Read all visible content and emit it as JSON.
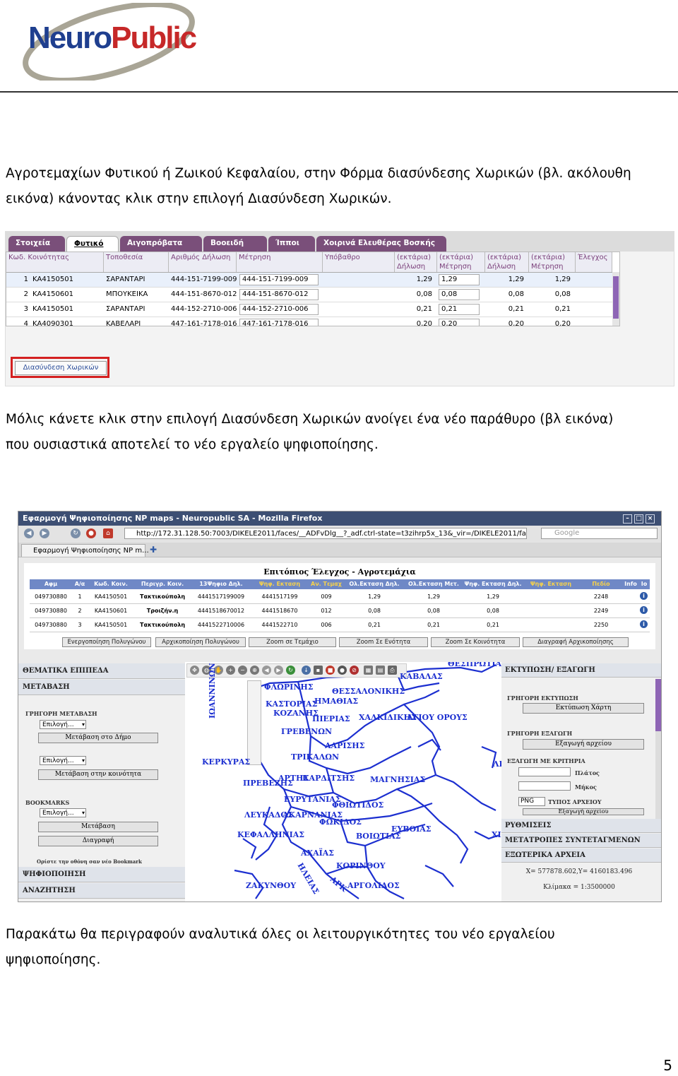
{
  "header": {
    "logo_text_part1": "Neuro",
    "logo_text_part2": "Public",
    "logo_colors": {
      "blue": "#1f3f8f",
      "red": "#c62828",
      "ring": "#a9a596"
    }
  },
  "paragraphs": {
    "p1_line1": "Αγροτεμαχίων Φυτικού ή Ζωικού Κεφαλαίου, στην Φόρμα διασύνδεσης Χωρικών (βλ. ακόλουθη",
    "p1_line2": "εικόνα) κάνοντας κλικ στην επιλογή Διασύνδεση Χωρικών.",
    "p2_line1": "Μόλις κάνετε κλικ στην επιλογή Διασύνδεση Χωρικών ανοίγει ένα νέο παράθυρο (βλ εικόνα)",
    "p2_line2": "που ουσιαστικά αποτελεί το νέο εργαλείο ψηφιοποίησης.",
    "p3_line1": "Παρακάτω θα περιγραφούν αναλυτικά όλες οι λειτουργικότητες του νέο εργαλείου",
    "p3_line2": "ψηφιοποίησης."
  },
  "page_number": "5",
  "screenshot1": {
    "tabs": [
      "Στοιχεία",
      "Φυτικό",
      "Αιγοπρόβατα",
      "Βοοειδή",
      "Ίπποι",
      "Χοιρινά Ελευθέρας Βοσκής"
    ],
    "active_tab": "Φυτικό",
    "headers": [
      "Κωδ. Κοινότητας",
      "Τοποθεσία",
      "Αριθμός Δήλωση",
      "Μέτρηση",
      "Υπόβαθρο",
      "(εκτάρια) Δήλωση",
      "(εκτάρια) Μέτρηση",
      "(εκτάρια) Δήλωση",
      "(εκτάρια) Μέτρηση",
      "Έλεγχος"
    ],
    "rows": [
      [
        "1",
        "ΚΑ4150501",
        "ΣΑΡΑΝΤΑΡΙ",
        "444-151-7199-009",
        "444-151-7199-009",
        "1,29",
        "1,29",
        "1,29",
        "1,29"
      ],
      [
        "2",
        "ΚΑ4150601",
        "ΜΠΟΥΚΕΙΚΑ",
        "444-151-8670-012",
        "444-151-8670-012",
        "0,08",
        "0,08",
        "0,08",
        "0,08"
      ],
      [
        "3",
        "ΚΑ4150501",
        "ΣΑΡΑΝΤΑΡΙ",
        "444-152-2710-006",
        "444-152-2710-006",
        "0,21",
        "0,21",
        "0,21",
        "0,21"
      ],
      [
        "4",
        "ΚΑ4090301",
        "ΚΑΒΕΛΑΡΙ",
        "447-161-7178-016",
        "447-161-7178-016",
        "0,20",
        "0,20",
        "0,20",
        "0,20"
      ]
    ],
    "link_button": "Διασύνδεση Χωρικών",
    "highlight_color": "#d42020"
  },
  "screenshot2": {
    "window_title": "Εφαρμογή Ψηφιοποίησης NP maps - Neuropublic SA - Mozilla Firefox",
    "url": "http://172.31.128.50:7003/DIKELE2011/faces/__ADFvDlg__?_adf.ctrl-state=t3zihrp5x_13&_vir=/DIKELE2011/faces",
    "search_placeholder": "Google",
    "tab_title": "Εφαρμογή Ψηφιοποίησης NP m...",
    "new_tab_symbol": "✚",
    "table_title": "Επιτόπιος Έλεγχος - Αγροτεμάχια",
    "table_headers": [
      "Αφμ",
      "Α/α",
      "Κωδ. Κοιν.",
      "Περιγρ. Κοιν.",
      "13Ψηφιο Δηλ.",
      "Ψηφ. Εκταση",
      "Αν. Τεμαχ",
      "Ολ.Εκταση Δηλ.",
      "Ολ.Εκταση Μετ.",
      "Ψηφ. Εκταση Δηλ.",
      "Ψηφ. Εκταση",
      "Πεδίο",
      "Info",
      "Ιο"
    ],
    "table_rows": [
      [
        "049730880",
        "1",
        "ΚΑ4150501",
        "Τακτικούπολη",
        "4441517199009",
        "4441517199",
        "009",
        "1,29",
        "1,29",
        "1,29",
        "2248"
      ],
      [
        "049730880",
        "2",
        "ΚΑ4150601",
        "Τροιζήν.η",
        "4441518670012",
        "4441518670",
        "012",
        "0,08",
        "0,08",
        "0,08",
        "2249"
      ],
      [
        "049730880",
        "3",
        "ΚΑ4150501",
        "Τακτικούπολη",
        "4441522710006",
        "4441522710",
        "006",
        "0,21",
        "0,21",
        "0,21",
        "2250"
      ]
    ],
    "table_buttons": [
      "Ενεργοποίηση Πολυγώνου",
      "Αρχικοποίηση Πολυγώνου",
      "Zoom σε Τεμάχιο",
      "Zoom Σε Ενότητα",
      "Zoom Σε Κοινότητα",
      "Διαγραφή Αρχικοποίησης"
    ],
    "left_panel": {
      "themes": "ΘΕΜΑΤΙΚΑ ΕΠΙΠΕΔΑ",
      "navigate": "ΜΕΤΑΒΑΣΗ",
      "quick_nav": "ΓΡΗΓΟΡΗ ΜΕΤΑΒΑΣΗ",
      "select1": "Επιλογή...",
      "btn_municipality": "Μετάβαση στο Δήμο",
      "select2": "Επιλογή...",
      "btn_community": "Μετάβαση στην κοινότητα",
      "bookmarks": "BOOKMARKS",
      "select3": "Επιλογή...",
      "btn_go": "Μετάβαση",
      "btn_delete": "Διαγραφή",
      "bookmark_note": "Ορίστε την οθόνη σαν νέο Bookmark",
      "digitize": "ΨΗΦΙΟΠΟΙΗΣΗ",
      "search": "ΑΝΑΖΗΤΗΣΗ"
    },
    "map": {
      "labels": [
        "ΚΑΒΑΛΑΣ",
        "ΦΛΩΡΙΝΗΣ",
        "ΘΕΣΣΑΛΟΝΙΚΗΣ",
        "ΚΑΣΤΟΡΙΑΣ",
        "ΗΜΑΘΙΑΣ",
        "ΚΟΖΑΝΗΣ",
        "ΠΙΕΡΙΑΣ",
        "ΧΑΛΚΙΔΙΚΗΣ",
        "ΑΓΙΟΥ ΟΡΟΥΣ",
        "ΓΡΕΒΕΝΩΝ",
        "ΛΑΡΙΣΗΣ",
        "ΚΕΡΚΥΡΑΣ",
        "ΤΡΙΚΑΛΩΝ",
        "ΛΕΣΒΟ",
        "ΠΡΕΒΕΖΗΣ",
        "ΑΡΤΗΣ",
        "ΚΑΡΔΙΤΣΗΣ",
        "ΜΑΓΝΗΣΙΑΣ",
        "ΕΥΡΥΤΑΝΙΑΣ",
        "ΦΘΙΩΤΙΔΟΣ",
        "ΛΕΥΚΑΔΟΣ",
        "ΑΚΑΡΝΑΝΙΑΣ",
        "ΦΩΚΙΔΟΣ",
        "ΕΥΒΟΙΑΣ",
        "ΚΕΦΑΛΛΗΝΙΑΣ",
        "ΒΟΙΩΤΙΑΣ",
        "ΧΙΟ",
        "ΑΧΑΪΑΣ",
        "ΚΟΡΙΝΘΟΥ",
        "ΖΑΚΥΝΘΟΥ",
        "ΗΛΕΙΑΣ",
        "ΑΡΚ",
        "ΑΡΓΟΛΙΔΟΣ",
        "ΘΕΣΠΡΩΤΙΑΣ",
        "ΙΩΑΝΝΙΝΩΝ"
      ],
      "label_color": "#1c2fd0"
    },
    "right_panel": {
      "print_export": "ΕΚΤΥΠΩΣΗ/ ΕΞΑΓΩΓΗ",
      "quick_print": "ΓΡΗΓΟΡΗ ΕΚΤΥΠΩΣΗ",
      "btn_print": "Εκτύπωση Χάρτη",
      "quick_export": "ΓΡΗΓΟΡΗ ΕΞΑΓΩΓΗ",
      "btn_export": "Εξαγωγή αρχείου",
      "export_criteria": "ΕΞΑΓΩΓΗ ΜΕ ΚΡΙΤΗΡΙΑ",
      "width_label": "Πλάτος",
      "length_label": "Μήκος",
      "file_type_value": "PNG",
      "file_type_label": "ΤΥΠΟΣ ΑΡΧΕΙΟΥ",
      "btn_export2": "Εξαγωγή αρχείου",
      "settings": "ΡΥΘΜΙΣΕΙΣ",
      "coord_transform": "ΜΕΤΑΤΡΟΠΕΣ ΣΥΝΤΕΤΑΓΜΕΝΩΝ",
      "external_files": "ΕΞΩΤΕΡΙΚΑ ΑΡΧΕΙΑ",
      "coords": "X= 577878.602,Y= 4160183.496",
      "scale": "Κλίμακα = 1:3500000"
    }
  }
}
